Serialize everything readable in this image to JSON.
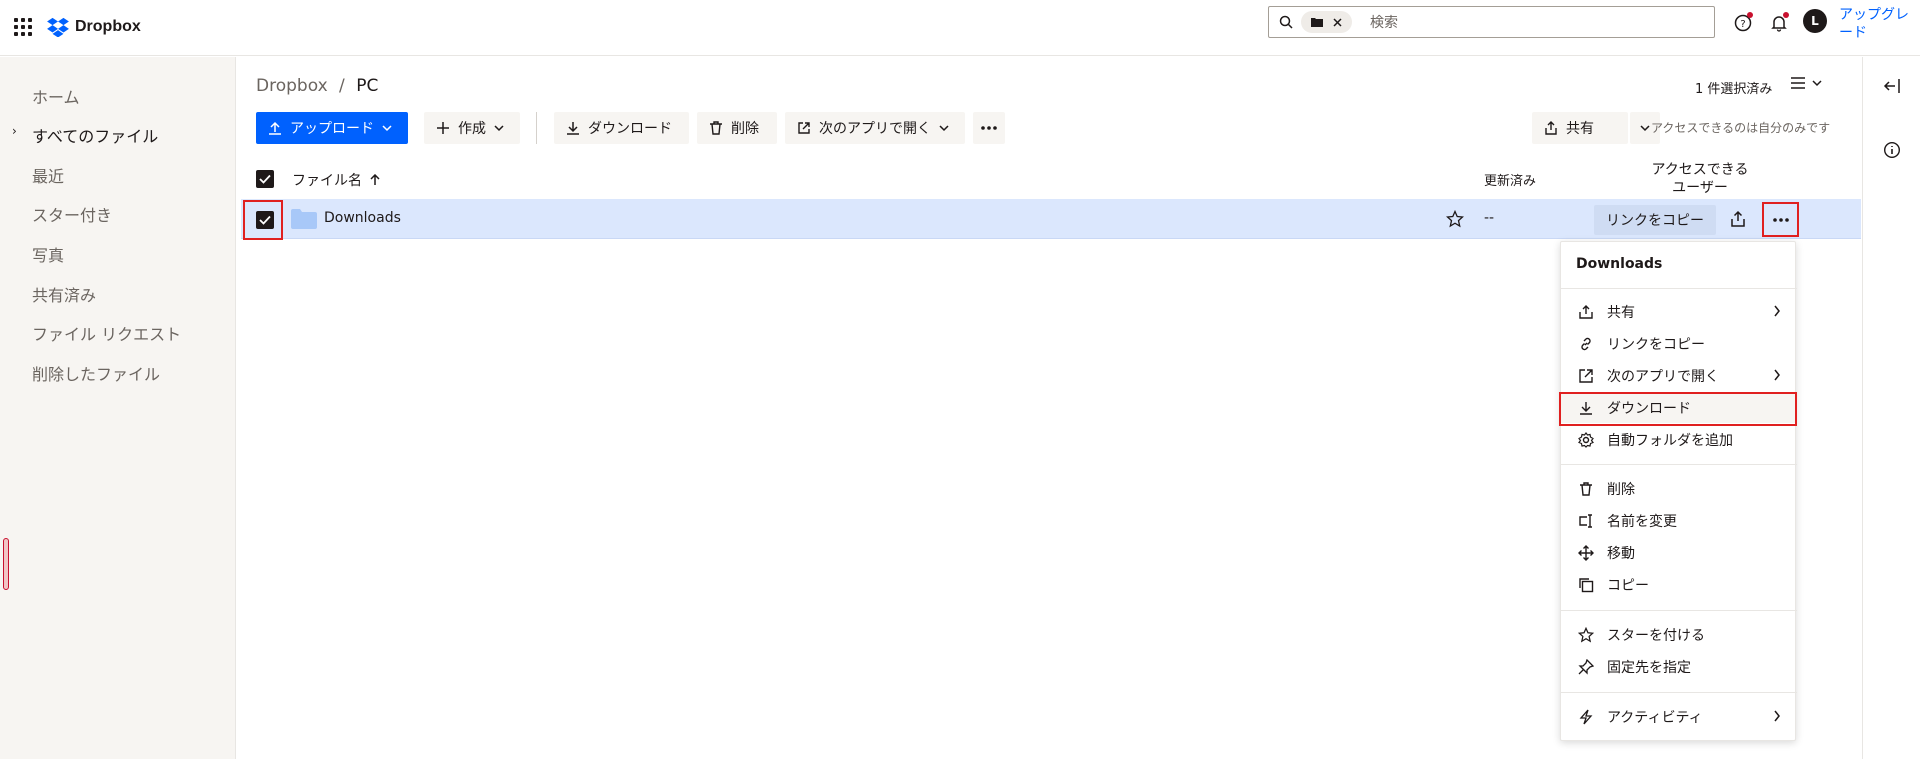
{
  "app": {
    "logo_text": "Dropbox",
    "upgrade_label": "アップグレード"
  },
  "search": {
    "chip_icon": "folder-icon",
    "placeholder": "検索"
  },
  "sidebar": {
    "items": [
      {
        "label": "ホーム"
      },
      {
        "label": "すべてのファイル",
        "active": true
      },
      {
        "label": "最近"
      },
      {
        "label": "スター付き"
      },
      {
        "label": "写真"
      },
      {
        "label": "共有済み"
      },
      {
        "label": "ファイル リクエスト"
      },
      {
        "label": "削除したファイル"
      }
    ]
  },
  "avatar": {
    "initial": "L"
  },
  "breadcrumb": {
    "root": "Dropbox",
    "sep": "/",
    "current": "PC"
  },
  "selection": {
    "count_label": "1 件選択済み"
  },
  "toolbar": {
    "upload": "アップロード",
    "create": "作成",
    "download": "ダウンロード",
    "delete": "削除",
    "open_in": "次のアプリで開く",
    "share": "共有",
    "access_note": "アクセスできるのは自分のみです"
  },
  "table": {
    "headers": {
      "name": "ファイル名",
      "modified": "更新済み",
      "access": "アクセスできる\nユーザー"
    },
    "rows": [
      {
        "name": "Downloads",
        "modified": "--",
        "copy_link": "リンクをコピー"
      }
    ]
  },
  "menu": {
    "title": "Downloads",
    "groups": [
      [
        {
          "label": "共有",
          "icon": "share-icon",
          "submenu": true
        },
        {
          "label": "リンクをコピー",
          "icon": "link-icon"
        },
        {
          "label": "次のアプリで開く",
          "icon": "open-in-icon",
          "submenu": true
        },
        {
          "label": "ダウンロード",
          "icon": "download-icon",
          "highlighted": true
        },
        {
          "label": "自動フォルダを追加",
          "icon": "gear-icon"
        }
      ],
      [
        {
          "label": "削除",
          "icon": "trash-icon"
        },
        {
          "label": "名前を変更",
          "icon": "rename-icon"
        },
        {
          "label": "移動",
          "icon": "move-icon"
        },
        {
          "label": "コピー",
          "icon": "copy-icon"
        }
      ],
      [
        {
          "label": "スターを付ける",
          "icon": "star-icon"
        },
        {
          "label": "固定先を指定",
          "icon": "pin-icon"
        }
      ],
      [
        {
          "label": "アクティビティ",
          "icon": "activity-icon",
          "submenu": true
        }
      ]
    ]
  },
  "colors": {
    "accent": "#0061fe",
    "selected_row": "#dbe7fd",
    "highlight_border": "#e02020"
  }
}
